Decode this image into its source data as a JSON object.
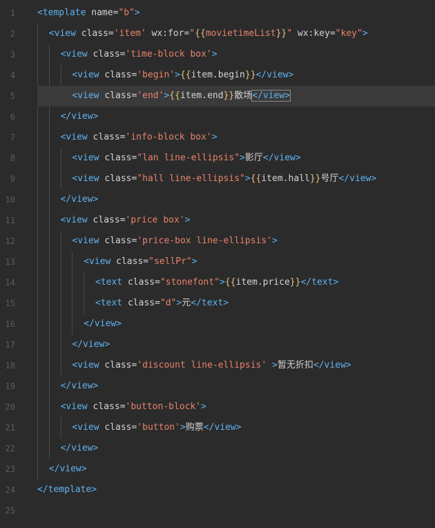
{
  "editor": {
    "colors": {
      "background": "#2b2b2b",
      "current_line": "#3a3a3a",
      "tag": "#5fb3f0",
      "attribute": "#d4d4d4",
      "string": "#e8836b",
      "brace": "#e5c07b",
      "line_number": "#5c5c5c"
    },
    "current_line": 5,
    "lines": [
      {
        "n": "1",
        "indent": 0,
        "tokens": [
          {
            "t": "tag",
            "v": "<template"
          },
          {
            "t": "attr",
            "v": " name="
          },
          {
            "t": "str",
            "v": "\"b\""
          },
          {
            "t": "tag",
            "v": ">"
          }
        ]
      },
      {
        "n": "2",
        "indent": 1,
        "tokens": [
          {
            "t": "tag",
            "v": "<view"
          },
          {
            "t": "attr",
            "v": " class="
          },
          {
            "t": "str",
            "v": "'item'"
          },
          {
            "t": "attr",
            "v": " wx:for="
          },
          {
            "t": "str",
            "v": "\""
          },
          {
            "t": "brace",
            "v": "{{"
          },
          {
            "t": "str",
            "v": "movietimeList"
          },
          {
            "t": "brace",
            "v": "}}"
          },
          {
            "t": "str",
            "v": "\""
          },
          {
            "t": "attr",
            "v": " wx:key="
          },
          {
            "t": "str",
            "v": "\"key\""
          },
          {
            "t": "tag",
            "v": ">"
          }
        ]
      },
      {
        "n": "3",
        "indent": 2,
        "tokens": [
          {
            "t": "tag",
            "v": "<view"
          },
          {
            "t": "attr",
            "v": " class="
          },
          {
            "t": "str",
            "v": "'time-block box'"
          },
          {
            "t": "tag",
            "v": ">"
          }
        ]
      },
      {
        "n": "4",
        "indent": 3,
        "tokens": [
          {
            "t": "tag",
            "v": "<view"
          },
          {
            "t": "attr",
            "v": " class="
          },
          {
            "t": "str",
            "v": "'begin'"
          },
          {
            "t": "tag",
            "v": ">"
          },
          {
            "t": "brace",
            "v": "{{"
          },
          {
            "t": "ident",
            "v": "item.begin"
          },
          {
            "t": "brace",
            "v": "}}"
          },
          {
            "t": "tag",
            "v": "</view>"
          }
        ]
      },
      {
        "n": "5",
        "indent": 3,
        "tokens": [
          {
            "t": "tag",
            "v": "<view"
          },
          {
            "t": "attr",
            "v": " class="
          },
          {
            "t": "str",
            "v": "'end'"
          },
          {
            "t": "tag",
            "v": ">"
          },
          {
            "t": "brace",
            "v": "{{"
          },
          {
            "t": "ident",
            "v": "item.end"
          },
          {
            "t": "brace",
            "v": "}}"
          },
          {
            "t": "txt",
            "v": "散场"
          },
          {
            "t": "tag",
            "v": "</view>"
          }
        ]
      },
      {
        "n": "6",
        "indent": 2,
        "tokens": [
          {
            "t": "tag",
            "v": "</view>"
          }
        ]
      },
      {
        "n": "7",
        "indent": 2,
        "tokens": [
          {
            "t": "tag",
            "v": "<view"
          },
          {
            "t": "attr",
            "v": " class="
          },
          {
            "t": "str",
            "v": "'info-block box'"
          },
          {
            "t": "tag",
            "v": ">"
          }
        ]
      },
      {
        "n": "8",
        "indent": 3,
        "tokens": [
          {
            "t": "tag",
            "v": "<view"
          },
          {
            "t": "attr",
            "v": " class="
          },
          {
            "t": "str",
            "v": "\"lan line-ellipsis\""
          },
          {
            "t": "tag",
            "v": ">"
          },
          {
            "t": "txt",
            "v": "影厅"
          },
          {
            "t": "tag",
            "v": "</view>"
          }
        ]
      },
      {
        "n": "9",
        "indent": 3,
        "tokens": [
          {
            "t": "tag",
            "v": "<view"
          },
          {
            "t": "attr",
            "v": " class="
          },
          {
            "t": "str",
            "v": "\"hall line-ellipsis\""
          },
          {
            "t": "tag",
            "v": ">"
          },
          {
            "t": "brace",
            "v": "{{"
          },
          {
            "t": "ident",
            "v": "item.hall"
          },
          {
            "t": "brace",
            "v": "}}"
          },
          {
            "t": "txt",
            "v": "号厅"
          },
          {
            "t": "tag",
            "v": "</view>"
          }
        ]
      },
      {
        "n": "10",
        "indent": 2,
        "tokens": [
          {
            "t": "tag",
            "v": "</view>"
          }
        ]
      },
      {
        "n": "11",
        "indent": 2,
        "tokens": [
          {
            "t": "tag",
            "v": "<view"
          },
          {
            "t": "attr",
            "v": " class="
          },
          {
            "t": "str",
            "v": "'price box'"
          },
          {
            "t": "tag",
            "v": ">"
          }
        ]
      },
      {
        "n": "12",
        "indent": 3,
        "tokens": [
          {
            "t": "tag",
            "v": "<view"
          },
          {
            "t": "attr",
            "v": " class="
          },
          {
            "t": "str",
            "v": "'price-box line-ellipsis'"
          },
          {
            "t": "tag",
            "v": ">"
          }
        ]
      },
      {
        "n": "13",
        "indent": 4,
        "tokens": [
          {
            "t": "tag",
            "v": "<view"
          },
          {
            "t": "attr",
            "v": " class="
          },
          {
            "t": "str",
            "v": "\"sellPr\""
          },
          {
            "t": "tag",
            "v": ">"
          }
        ]
      },
      {
        "n": "14",
        "indent": 5,
        "tokens": [
          {
            "t": "tag",
            "v": "<text"
          },
          {
            "t": "attr",
            "v": " class="
          },
          {
            "t": "str",
            "v": "\"stonefont\""
          },
          {
            "t": "tag",
            "v": ">"
          },
          {
            "t": "brace",
            "v": "{{"
          },
          {
            "t": "ident",
            "v": "item.price"
          },
          {
            "t": "brace",
            "v": "}}"
          },
          {
            "t": "tag",
            "v": "</text>"
          }
        ]
      },
      {
        "n": "15",
        "indent": 5,
        "tokens": [
          {
            "t": "tag",
            "v": "<text"
          },
          {
            "t": "attr",
            "v": " class="
          },
          {
            "t": "str",
            "v": "\"d\""
          },
          {
            "t": "tag",
            "v": ">"
          },
          {
            "t": "txt",
            "v": "元"
          },
          {
            "t": "tag",
            "v": "</text>"
          }
        ]
      },
      {
        "n": "16",
        "indent": 4,
        "tokens": [
          {
            "t": "tag",
            "v": "</view>"
          }
        ]
      },
      {
        "n": "17",
        "indent": 3,
        "tokens": [
          {
            "t": "tag",
            "v": "</view>"
          }
        ]
      },
      {
        "n": "18",
        "indent": 3,
        "tokens": [
          {
            "t": "tag",
            "v": "<view"
          },
          {
            "t": "attr",
            "v": " class="
          },
          {
            "t": "str",
            "v": "'discount line-ellipsis'"
          },
          {
            "t": "attr",
            "v": " "
          },
          {
            "t": "tag",
            "v": ">"
          },
          {
            "t": "txt",
            "v": "暂无折扣"
          },
          {
            "t": "tag",
            "v": "</view>"
          }
        ]
      },
      {
        "n": "19",
        "indent": 2,
        "tokens": [
          {
            "t": "tag",
            "v": "</view>"
          }
        ]
      },
      {
        "n": "20",
        "indent": 2,
        "tokens": [
          {
            "t": "tag",
            "v": "<view"
          },
          {
            "t": "attr",
            "v": " class="
          },
          {
            "t": "str",
            "v": "'button-block'"
          },
          {
            "t": "tag",
            "v": ">"
          }
        ]
      },
      {
        "n": "21",
        "indent": 3,
        "tokens": [
          {
            "t": "tag",
            "v": "<view"
          },
          {
            "t": "attr",
            "v": " class="
          },
          {
            "t": "str",
            "v": "'button'"
          },
          {
            "t": "tag",
            "v": ">"
          },
          {
            "t": "txt",
            "v": "购票"
          },
          {
            "t": "tag",
            "v": "</view>"
          }
        ]
      },
      {
        "n": "22",
        "indent": 2,
        "tokens": [
          {
            "t": "tag",
            "v": "</view>"
          }
        ]
      },
      {
        "n": "23",
        "indent": 1,
        "tokens": [
          {
            "t": "tag",
            "v": "</view>"
          }
        ]
      },
      {
        "n": "24",
        "indent": 0,
        "tokens": [
          {
            "t": "tag",
            "v": "</template>"
          }
        ]
      },
      {
        "n": "25",
        "indent": 0,
        "tokens": []
      }
    ]
  }
}
